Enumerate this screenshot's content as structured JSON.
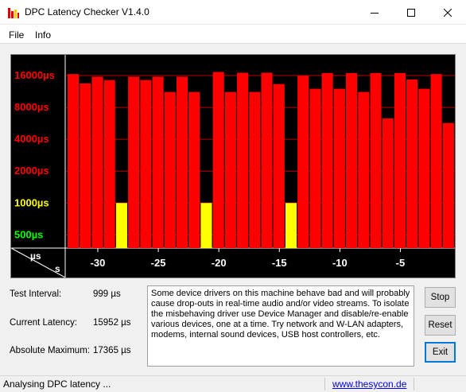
{
  "window": {
    "title": "DPC Latency Checker V1.4.0"
  },
  "menu": {
    "file": "File",
    "info": "Info"
  },
  "chart_data": {
    "type": "bar",
    "y_scale": "log",
    "ytick_labels": [
      "16000µs",
      "8000µs",
      "4000µs",
      "2000µs",
      "1000µs",
      "500µs"
    ],
    "ytick_colors": [
      "#ff0000",
      "#ff0000",
      "#ff0000",
      "#ff0000",
      "#ffff00",
      "#00ff00"
    ],
    "xtick_labels": [
      "-30",
      "-25",
      "-20",
      "-15",
      "-10",
      "-5"
    ],
    "xtick_values": [
      -30,
      -25,
      -20,
      -15,
      -10,
      -5
    ],
    "corner_labels": {
      "top": "µs",
      "bottom": "s"
    },
    "x": [
      -32,
      -31,
      -30,
      -29,
      -28,
      -27,
      -26,
      -25,
      -24,
      -23,
      -22,
      -21,
      -20,
      -19,
      -18,
      -17,
      -16,
      -15,
      -14,
      -13,
      -12,
      -11,
      -10,
      -9,
      -8,
      -7,
      -6,
      -5,
      -4,
      -3,
      -2,
      -1
    ],
    "values": [
      16500,
      13500,
      15600,
      14500,
      1000,
      15600,
      14500,
      15600,
      11200,
      15600,
      11200,
      1000,
      17300,
      11200,
      17000,
      11200,
      17000,
      13300,
      1000,
      15900,
      12000,
      16900,
      12000,
      16900,
      11200,
      16900,
      6300,
      16900,
      14700,
      12000,
      16500,
      5700
    ],
    "colors": [
      "red",
      "red",
      "red",
      "red",
      "yellow",
      "red",
      "red",
      "red",
      "red",
      "red",
      "red",
      "yellow",
      "red",
      "red",
      "red",
      "red",
      "red",
      "red",
      "yellow",
      "red",
      "red",
      "red",
      "red",
      "red",
      "red",
      "red",
      "red",
      "red",
      "red",
      "red",
      "red",
      "red"
    ],
    "color_map": {
      "red": "#ff0000",
      "yellow": "#ffff00"
    },
    "grid_color": "#c00000",
    "background": "#000000"
  },
  "stats": {
    "test_interval_label": "Test Interval:",
    "test_interval_value": "999 µs",
    "current_latency_label": "Current Latency:",
    "current_latency_value": "15952 µs",
    "absolute_max_label": "Absolute Maximum:",
    "absolute_max_value": "17365 µs"
  },
  "message": "Some device drivers on this machine behave bad and will probably cause drop-outs in real-time audio and/or video streams. To isolate the misbehaving driver use Device Manager and disable/re-enable various devices, one at a time. Try network and W-LAN adapters, modems, internal sound devices, USB host controllers, etc.",
  "buttons": {
    "stop": "Stop",
    "reset": "Reset",
    "exit": "Exit"
  },
  "status": {
    "text": "Analysing DPC latency ...",
    "link": "www.thesycon.de"
  }
}
